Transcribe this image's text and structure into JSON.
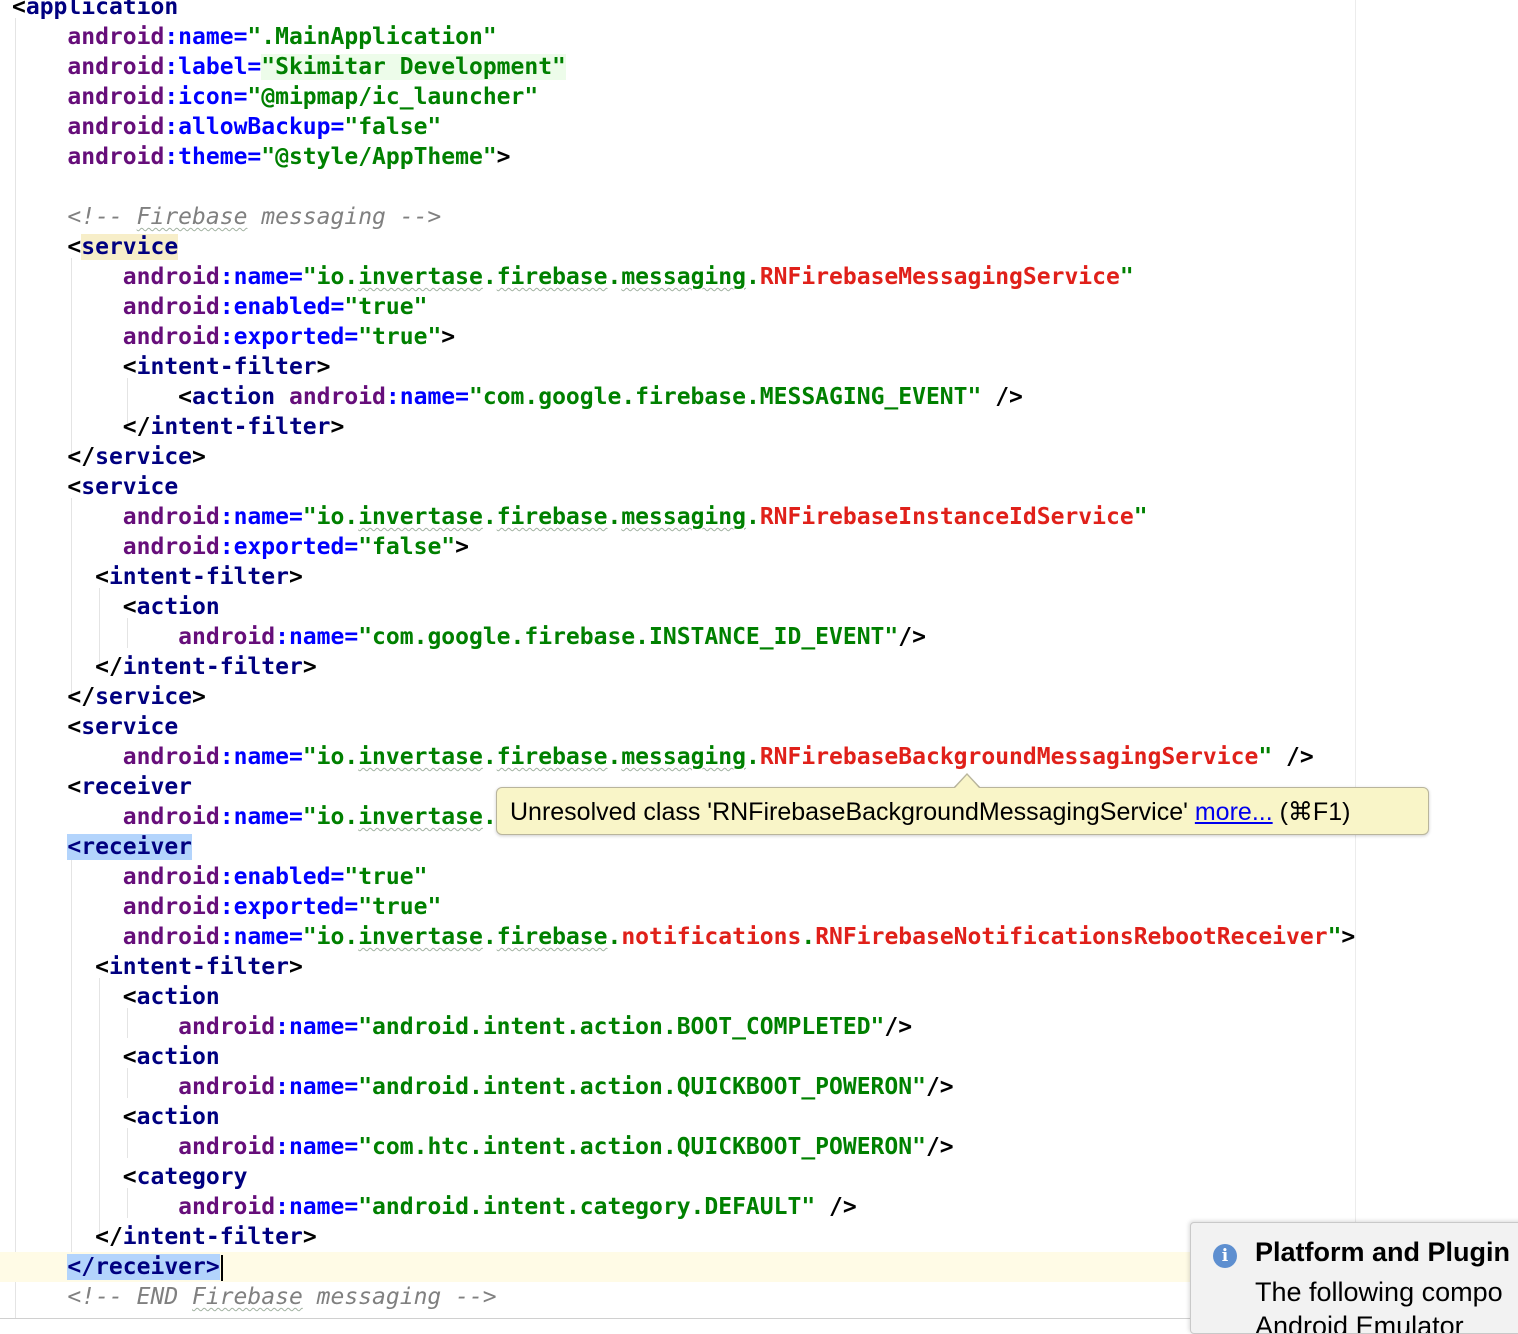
{
  "editor": {
    "lines": [
      [
        {
          "t": "<",
          "c": "punc"
        },
        {
          "t": "application",
          "c": "tag"
        }
      ],
      [
        {
          "t": "    "
        },
        {
          "t": "android",
          "c": "ns"
        },
        {
          "t": ":name=",
          "c": "attr"
        },
        {
          "t": "\".MainApplication\"",
          "c": "val"
        }
      ],
      [
        {
          "t": "    "
        },
        {
          "t": "android",
          "c": "ns"
        },
        {
          "t": ":label=",
          "c": "attr"
        },
        {
          "t": "\"Skimitar Development\"",
          "c": "val",
          "h": "soft"
        }
      ],
      [
        {
          "t": "    "
        },
        {
          "t": "android",
          "c": "ns"
        },
        {
          "t": ":icon=",
          "c": "attr"
        },
        {
          "t": "\"@mipmap/ic_launcher\"",
          "c": "val"
        }
      ],
      [
        {
          "t": "    "
        },
        {
          "t": "android",
          "c": "ns"
        },
        {
          "t": ":allowBackup=",
          "c": "attr"
        },
        {
          "t": "\"false\"",
          "c": "val"
        }
      ],
      [
        {
          "t": "    "
        },
        {
          "t": "android",
          "c": "ns"
        },
        {
          "t": ":theme=",
          "c": "attr"
        },
        {
          "t": "\"@style/AppTheme\"",
          "c": "val"
        },
        {
          "t": ">",
          "c": "punc"
        }
      ],
      [],
      [
        {
          "t": "    "
        },
        {
          "t": "<!-- ",
          "c": "comment"
        },
        {
          "t": "Firebase",
          "c": "comment",
          "w": true
        },
        {
          "t": " messaging -->",
          "c": "comment"
        }
      ],
      [
        {
          "t": "    "
        },
        {
          "t": "<",
          "c": "punc"
        },
        {
          "t": "service",
          "c": "tag",
          "h": "match"
        }
      ],
      [
        {
          "t": "        "
        },
        {
          "t": "android",
          "c": "ns"
        },
        {
          "t": ":name=",
          "c": "attr"
        },
        {
          "t": "\"io.",
          "c": "val"
        },
        {
          "t": "invertase",
          "c": "val",
          "w": true
        },
        {
          "t": ".",
          "c": "val"
        },
        {
          "t": "firebase",
          "c": "val",
          "w": true
        },
        {
          "t": ".",
          "c": "val"
        },
        {
          "t": "messaging",
          "c": "val",
          "w": true
        },
        {
          "t": ".",
          "c": "val"
        },
        {
          "t": "RNFirebaseMessagingService",
          "c": "err"
        },
        {
          "t": "\"",
          "c": "val"
        }
      ],
      [
        {
          "t": "        "
        },
        {
          "t": "android",
          "c": "ns"
        },
        {
          "t": ":enabled=",
          "c": "attr"
        },
        {
          "t": "\"true\"",
          "c": "val"
        }
      ],
      [
        {
          "t": "        "
        },
        {
          "t": "android",
          "c": "ns"
        },
        {
          "t": ":exported=",
          "c": "attr"
        },
        {
          "t": "\"true\"",
          "c": "val"
        },
        {
          "t": ">",
          "c": "punc"
        }
      ],
      [
        {
          "t": "        "
        },
        {
          "t": "<",
          "c": "punc"
        },
        {
          "t": "intent-filter",
          "c": "tag"
        },
        {
          "t": ">",
          "c": "punc"
        }
      ],
      [
        {
          "t": "            "
        },
        {
          "t": "<",
          "c": "punc"
        },
        {
          "t": "action ",
          "c": "tag"
        },
        {
          "t": "android",
          "c": "ns"
        },
        {
          "t": ":name=",
          "c": "attr"
        },
        {
          "t": "\"com.google.firebase.MESSAGING_EVENT\"",
          "c": "val"
        },
        {
          "t": " />",
          "c": "punc"
        }
      ],
      [
        {
          "t": "        "
        },
        {
          "t": "</",
          "c": "punc"
        },
        {
          "t": "intent-filter",
          "c": "tag"
        },
        {
          "t": ">",
          "c": "punc"
        }
      ],
      [
        {
          "t": "    "
        },
        {
          "t": "</",
          "c": "punc"
        },
        {
          "t": "service",
          "c": "tag"
        },
        {
          "t": ">",
          "c": "punc"
        }
      ],
      [
        {
          "t": "    "
        },
        {
          "t": "<",
          "c": "punc"
        },
        {
          "t": "service",
          "c": "tag"
        }
      ],
      [
        {
          "t": "        "
        },
        {
          "t": "android",
          "c": "ns"
        },
        {
          "t": ":name=",
          "c": "attr"
        },
        {
          "t": "\"io.",
          "c": "val"
        },
        {
          "t": "invertase",
          "c": "val",
          "w": true
        },
        {
          "t": ".",
          "c": "val"
        },
        {
          "t": "firebase",
          "c": "val",
          "w": true
        },
        {
          "t": ".",
          "c": "val"
        },
        {
          "t": "messaging",
          "c": "val",
          "w": true
        },
        {
          "t": ".",
          "c": "val"
        },
        {
          "t": "RNFirebaseInstanceIdService",
          "c": "err"
        },
        {
          "t": "\"",
          "c": "val"
        }
      ],
      [
        {
          "t": "        "
        },
        {
          "t": "android",
          "c": "ns"
        },
        {
          "t": ":exported=",
          "c": "attr"
        },
        {
          "t": "\"false\"",
          "c": "val"
        },
        {
          "t": ">",
          "c": "punc"
        }
      ],
      [
        {
          "t": "      "
        },
        {
          "t": "<",
          "c": "punc"
        },
        {
          "t": "intent-filter",
          "c": "tag"
        },
        {
          "t": ">",
          "c": "punc"
        }
      ],
      [
        {
          "t": "        "
        },
        {
          "t": "<",
          "c": "punc"
        },
        {
          "t": "action",
          "c": "tag"
        }
      ],
      [
        {
          "t": "            "
        },
        {
          "t": "android",
          "c": "ns"
        },
        {
          "t": ":name=",
          "c": "attr"
        },
        {
          "t": "\"com.google.firebase.INSTANCE_ID_EVENT\"",
          "c": "val"
        },
        {
          "t": "/>",
          "c": "punc"
        }
      ],
      [
        {
          "t": "      "
        },
        {
          "t": "</",
          "c": "punc"
        },
        {
          "t": "intent-filter",
          "c": "tag"
        },
        {
          "t": ">",
          "c": "punc"
        }
      ],
      [
        {
          "t": "    "
        },
        {
          "t": "</",
          "c": "punc"
        },
        {
          "t": "service",
          "c": "tag"
        },
        {
          "t": ">",
          "c": "punc"
        }
      ],
      [
        {
          "t": "    "
        },
        {
          "t": "<",
          "c": "punc"
        },
        {
          "t": "service",
          "c": "tag"
        }
      ],
      [
        {
          "t": "        "
        },
        {
          "t": "android",
          "c": "ns"
        },
        {
          "t": ":name=",
          "c": "attr"
        },
        {
          "t": "\"io.",
          "c": "val"
        },
        {
          "t": "invertase",
          "c": "val",
          "w": true
        },
        {
          "t": ".",
          "c": "val"
        },
        {
          "t": "firebase",
          "c": "val",
          "w": true
        },
        {
          "t": ".",
          "c": "val"
        },
        {
          "t": "messaging",
          "c": "val",
          "w": true
        },
        {
          "t": ".",
          "c": "val"
        },
        {
          "t": "RNFirebaseBackgroundMessagingService",
          "c": "err"
        },
        {
          "t": "\"",
          "c": "val"
        },
        {
          "t": " />",
          "c": "punc"
        }
      ],
      [
        {
          "t": "    "
        },
        {
          "t": "<",
          "c": "punc"
        },
        {
          "t": "receiver",
          "c": "tag"
        }
      ],
      [
        {
          "t": "        "
        },
        {
          "t": "android",
          "c": "ns"
        },
        {
          "t": ":name=",
          "c": "attr"
        },
        {
          "t": "\"io.",
          "c": "val"
        },
        {
          "t": "invertase",
          "c": "val",
          "w": true
        },
        {
          "t": ".",
          "c": "val"
        }
      ],
      [
        {
          "t": "    "
        },
        {
          "t": "<receiver",
          "c": "tag",
          "h": "sel"
        }
      ],
      [
        {
          "t": "        "
        },
        {
          "t": "android",
          "c": "ns"
        },
        {
          "t": ":enabled=",
          "c": "attr"
        },
        {
          "t": "\"true\"",
          "c": "val"
        }
      ],
      [
        {
          "t": "        "
        },
        {
          "t": "android",
          "c": "ns"
        },
        {
          "t": ":exported=",
          "c": "attr"
        },
        {
          "t": "\"true\"",
          "c": "val"
        }
      ],
      [
        {
          "t": "        "
        },
        {
          "t": "android",
          "c": "ns"
        },
        {
          "t": ":name=",
          "c": "attr"
        },
        {
          "t": "\"io.",
          "c": "val"
        },
        {
          "t": "invertase",
          "c": "val",
          "w": true
        },
        {
          "t": ".",
          "c": "val"
        },
        {
          "t": "firebase",
          "c": "val",
          "w": true
        },
        {
          "t": ".",
          "c": "val"
        },
        {
          "t": "notifications",
          "c": "err"
        },
        {
          "t": ".",
          "c": "val"
        },
        {
          "t": "RNFirebaseNotificationsRebootReceiver",
          "c": "err"
        },
        {
          "t": "\"",
          "c": "val"
        },
        {
          "t": ">",
          "c": "punc"
        }
      ],
      [
        {
          "t": "      "
        },
        {
          "t": "<",
          "c": "punc"
        },
        {
          "t": "intent-filter",
          "c": "tag"
        },
        {
          "t": ">",
          "c": "punc"
        }
      ],
      [
        {
          "t": "        "
        },
        {
          "t": "<",
          "c": "punc"
        },
        {
          "t": "action",
          "c": "tag"
        }
      ],
      [
        {
          "t": "            "
        },
        {
          "t": "android",
          "c": "ns"
        },
        {
          "t": ":name=",
          "c": "attr"
        },
        {
          "t": "\"android.intent.action.BOOT_COMPLETED\"",
          "c": "val"
        },
        {
          "t": "/>",
          "c": "punc"
        }
      ],
      [
        {
          "t": "        "
        },
        {
          "t": "<",
          "c": "punc"
        },
        {
          "t": "action",
          "c": "tag"
        }
      ],
      [
        {
          "t": "            "
        },
        {
          "t": "android",
          "c": "ns"
        },
        {
          "t": ":name=",
          "c": "attr"
        },
        {
          "t": "\"android.intent.action.QUICKBOOT_POWERON\"",
          "c": "val"
        },
        {
          "t": "/>",
          "c": "punc"
        }
      ],
      [
        {
          "t": "        "
        },
        {
          "t": "<",
          "c": "punc"
        },
        {
          "t": "action",
          "c": "tag"
        }
      ],
      [
        {
          "t": "            "
        },
        {
          "t": "android",
          "c": "ns"
        },
        {
          "t": ":name=",
          "c": "attr"
        },
        {
          "t": "\"com.htc.intent.action.QUICKBOOT_POWERON\"",
          "c": "val"
        },
        {
          "t": "/>",
          "c": "punc"
        }
      ],
      [
        {
          "t": "        "
        },
        {
          "t": "<",
          "c": "punc"
        },
        {
          "t": "category",
          "c": "tag"
        }
      ],
      [
        {
          "t": "            "
        },
        {
          "t": "android",
          "c": "ns"
        },
        {
          "t": ":name=",
          "c": "attr"
        },
        {
          "t": "\"android.intent.category.DEFAULT\"",
          "c": "val"
        },
        {
          "t": " />",
          "c": "punc"
        }
      ],
      [
        {
          "t": "      "
        },
        {
          "t": "</",
          "c": "punc"
        },
        {
          "t": "intent-filter",
          "c": "tag"
        },
        {
          "t": ">",
          "c": "punc"
        }
      ],
      [
        {
          "t": "    "
        },
        {
          "t": "</receiver>",
          "c": "tag",
          "h": "sel"
        },
        {
          "t": "",
          "caret": true
        }
      ],
      [
        {
          "t": "    "
        },
        {
          "t": "<!-- END ",
          "c": "comment"
        },
        {
          "t": "Firebase",
          "c": "comment",
          "w": true
        },
        {
          "t": " messaging -->",
          "c": "comment"
        }
      ]
    ]
  },
  "tooltip": {
    "message": "Unresolved class 'RNFirebaseBackgroundMessagingService'",
    "link": "more...",
    "shortcut": "(⌘F1)"
  },
  "notification": {
    "icon": "info-icon",
    "title": "Platform and Plugin",
    "body": "The following compo",
    "body2": "Android Emulator"
  }
}
